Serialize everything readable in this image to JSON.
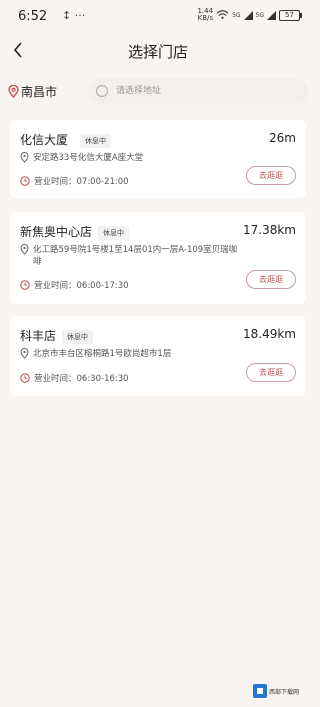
{
  "status_bar": {
    "time": "6:52",
    "extra": "↕ ···",
    "network_speed_value": "1.44",
    "network_speed_unit": "KB/s",
    "signal_1": "5G",
    "signal_2": "5G",
    "battery": "57"
  },
  "nav": {
    "title": "选择门店"
  },
  "location": {
    "city": "南昌市",
    "search_placeholder": "请选择地址"
  },
  "stores": [
    {
      "name": "化信大厦",
      "status": "休息中",
      "distance": "26m",
      "address": "安定路33号化信大厦A座大堂",
      "hours": "营业时间：07:00-21:00",
      "button": "去逛逛"
    },
    {
      "name": "新焦奥中心店",
      "status": "休息中",
      "distance": "17.38km",
      "address": "化工路59号院1号楼1至14层01内一层A-109室贝瑞咖啡",
      "hours": "营业时间：06:00-17:30",
      "button": "去逛逛"
    },
    {
      "name": "科丰店",
      "status": "休息中",
      "distance": "18.49km",
      "address": "北京市丰台区榕桐路1号欧尚超市1层",
      "hours": "营业时间：06:30-16:30",
      "button": "去逛逛"
    }
  ],
  "watermark": {
    "text": "西部下载网"
  },
  "colors": {
    "accent": "#b34848",
    "background": "#f7f4f2",
    "card": "#ffffff"
  }
}
